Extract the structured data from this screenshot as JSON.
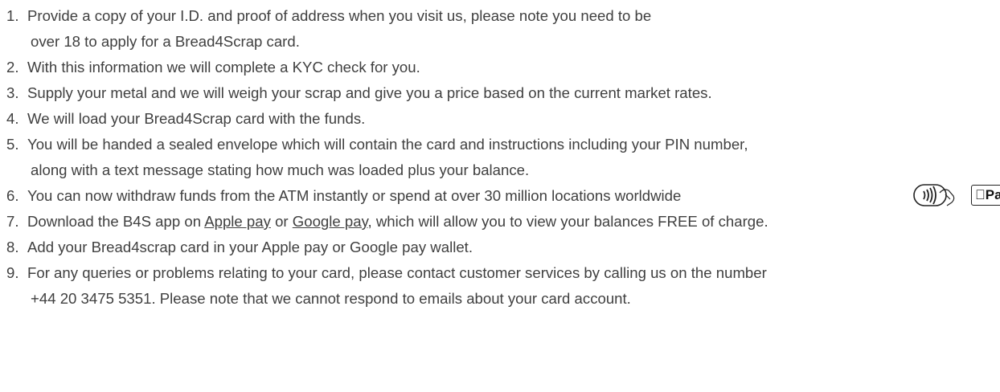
{
  "steps": [
    {
      "num": "1.",
      "line1": "Provide a copy of your I.D. and proof of address when you visit us, please note you need to be",
      "line2": "over 18 to apply for a Bread4Scrap card."
    },
    {
      "num": "2.",
      "line1": "With this information we will complete a KYC check for you."
    },
    {
      "num": "3.",
      "line1": "Supply your metal and we will weigh your scrap and give you a price based on the current market rates."
    },
    {
      "num": "4.",
      "line1": "We will load your Bread4Scrap card with the funds."
    },
    {
      "num": "5.",
      "line1": "You will be handed a sealed envelope which will contain the card and instructions including your PIN number,",
      "line2": "along with a text message stating how much was loaded plus your balance."
    },
    {
      "num": "6.",
      "line1": "You can now withdraw funds from the ATM instantly or spend at over 30 million locations worldwide"
    },
    {
      "num": "7.",
      "pre": "Download the B4S app on ",
      "link1": "Apple pay",
      "mid": " or ",
      "link2": "Google pay",
      "post": ", which will allow you to view your balances FREE of charge."
    },
    {
      "num": "8.",
      "line1": "Add your Bread4scrap card in your Apple pay or Google pay wallet."
    },
    {
      "num": "9.",
      "line1": "For any queries or problems relating to your card, please contact customer services by calling us on the number",
      "line2": "+44 20 3475 5351. Please note that we cannot respond to emails about your card account."
    }
  ],
  "badges": {
    "contactless_icon": "contactless-icon",
    "apple_pay_label": "Pay"
  }
}
